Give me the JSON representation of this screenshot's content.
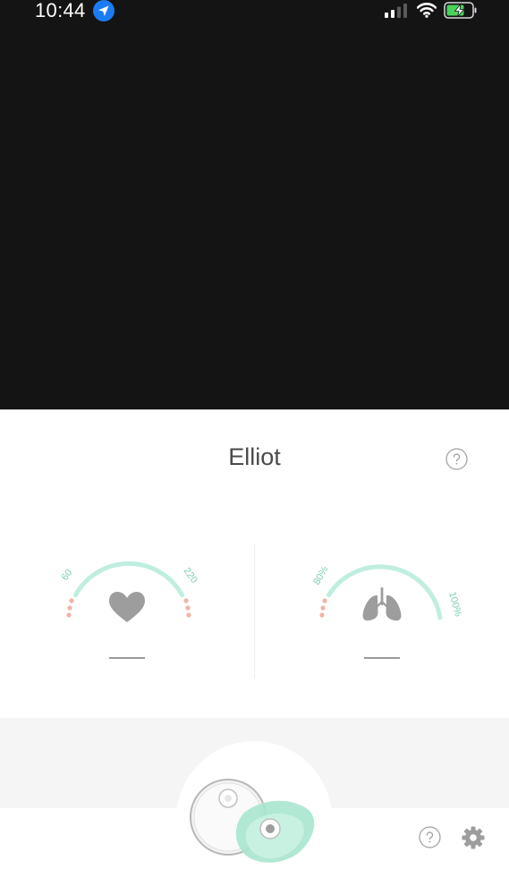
{
  "status_bar": {
    "time": "10:44",
    "icons": [
      "location-arrow-icon",
      "cellular-signal-icon",
      "wifi-icon",
      "battery-charging-icon"
    ]
  },
  "monitor": {
    "baby_name": "Elliot",
    "heart_rate": {
      "icon": "heart-icon",
      "min_label": "60",
      "max_label": "220",
      "reading": "—"
    },
    "oxygen": {
      "icon": "lungs-icon",
      "min_label": "80%",
      "max_label": "100%",
      "reading": "—"
    }
  },
  "tab_bar": {
    "icons": [
      "base-station-icon",
      "help-icon",
      "gear-icon"
    ]
  },
  "colors": {
    "video_background": "#141414",
    "gauge_green": "#bfeee0",
    "gauge_label_green": "#7ecfb3",
    "gauge_dot_pink": "#f2b3a3",
    "icon_gray": "#9d9d9d"
  }
}
